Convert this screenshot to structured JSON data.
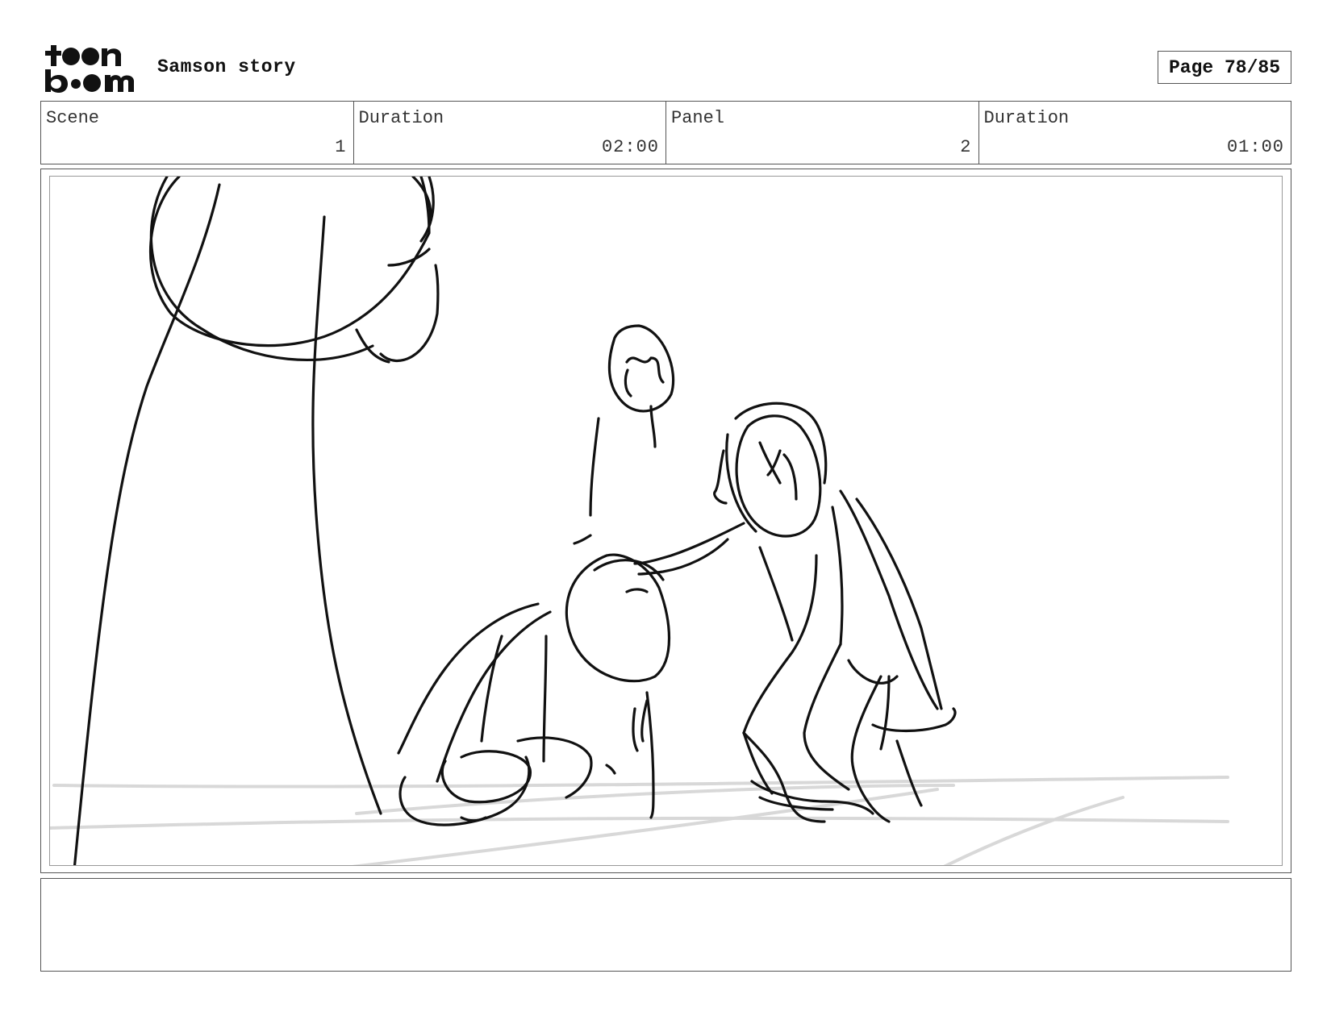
{
  "header": {
    "logo_text": "toon boom",
    "title": "Samson story",
    "page_label": "Page 78/85"
  },
  "info": {
    "scene_label": "Scene",
    "scene_value": "1",
    "scene_duration_label": "Duration",
    "scene_duration_value": "02:00",
    "panel_label": "Panel",
    "panel_value": "2",
    "panel_duration_label": "Duration",
    "panel_duration_value": "01:00"
  },
  "notes": {
    "text": ""
  }
}
